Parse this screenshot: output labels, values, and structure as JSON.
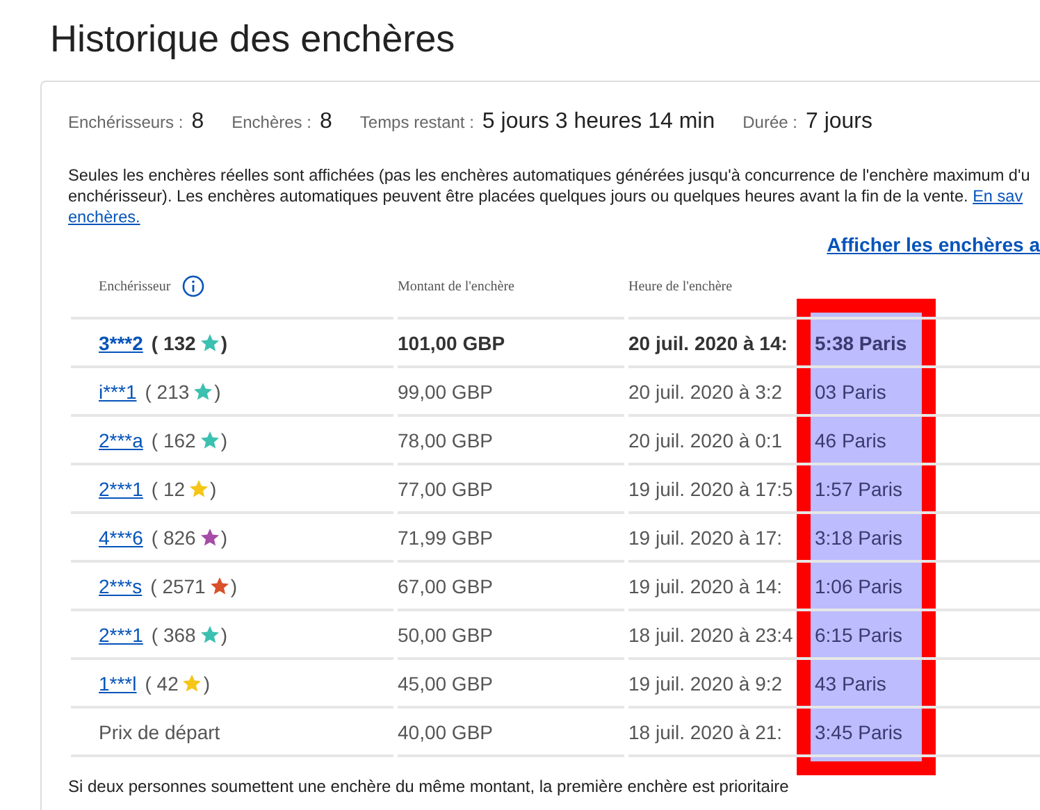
{
  "title": "Historique des enchères",
  "stats": [
    {
      "label": "Enchérisseurs :",
      "value": "8"
    },
    {
      "label": "Enchères :",
      "value": "8"
    },
    {
      "label": "Temps restant :",
      "value": "5 jours 3 heures 14 min"
    },
    {
      "label": "Durée :",
      "value": "7 jours"
    }
  ],
  "notice": {
    "lines": [
      "Seules les enchères réelles sont affichées (pas les enchères automatiques générées jusqu'à concurrence de l'enchère maximum d'u",
      "enchérisseur). Les enchères automatiques peuvent être placées quelques jours ou quelques heures avant la fin de la vente."
    ],
    "link_parts": [
      "En sav",
      "enchères."
    ]
  },
  "show_link": "Afficher les enchères a",
  "table": {
    "columns": [
      "Enchérisseur",
      "Montant de l'enchère",
      "Heure de l'enchère"
    ],
    "rows": [
      {
        "kind": "bid",
        "bidder": "3***2",
        "score": "( 132",
        "close": ")",
        "color": "#3cc0b0",
        "amount": "101,00 GBP",
        "time_start": "20 juil. 2020 à 14:",
        "time_end": "5:38 Paris",
        "highlighted": true
      },
      {
        "kind": "bid",
        "bidder": "i***1",
        "score": "( 213",
        "close": ")",
        "color": "#3cc0b0",
        "amount": "99,00 GBP",
        "time_start": "20 juil. 2020 à 3:2",
        "time_end": "03 Paris",
        "highlighted": false
      },
      {
        "kind": "bid",
        "bidder": "2***a",
        "score": "( 162",
        "close": ")",
        "color": "#3cc0b0",
        "amount": "78,00 GBP",
        "time_start": "20 juil. 2020 à 0:1",
        "time_end": "46 Paris",
        "highlighted": false
      },
      {
        "kind": "bid",
        "bidder": "2***1",
        "score": "( 12",
        "close": ")",
        "color": "#f5c518",
        "amount": "77,00 GBP",
        "time_start": "19 juil. 2020 à 17:5",
        "time_end": "1:57 Paris",
        "highlighted": false
      },
      {
        "kind": "bid",
        "bidder": "4***6",
        "score": "( 826",
        "close": ")",
        "color": "#a64ca6",
        "amount": "71,99 GBP",
        "time_start": "19 juil. 2020 à 17:",
        "time_end": "3:18 Paris",
        "highlighted": false
      },
      {
        "kind": "bid",
        "bidder": "2***s",
        "score": "( 2571",
        "close": ")",
        "color": "#d9502a",
        "amount": "67,00 GBP",
        "time_start": "19 juil. 2020 à 14:",
        "time_end": "1:06 Paris",
        "highlighted": false
      },
      {
        "kind": "bid",
        "bidder": "2***1",
        "score": "( 368",
        "close": ")",
        "color": "#3cc0b0",
        "amount": "50,00 GBP",
        "time_start": "18 juil. 2020 à 23:4",
        "time_end": "6:15 Paris",
        "highlighted": false
      },
      {
        "kind": "bid",
        "bidder": "1***l",
        "score": "( 42",
        "close": ")",
        "color": "#f5c518",
        "amount": "45,00 GBP",
        "time_start": "19 juil. 2020 à 9:2",
        "time_end": "43 Paris",
        "highlighted": false
      },
      {
        "kind": "start",
        "bidder": "Prix de départ",
        "amount": "40,00 GBP",
        "time_start": "18 juil. 2020 à 21:",
        "time_end": "3:45 Paris",
        "highlighted": false
      }
    ]
  },
  "footnote": "Si deux personnes soumettent une enchère du même montant, la première enchère est prioritaire"
}
